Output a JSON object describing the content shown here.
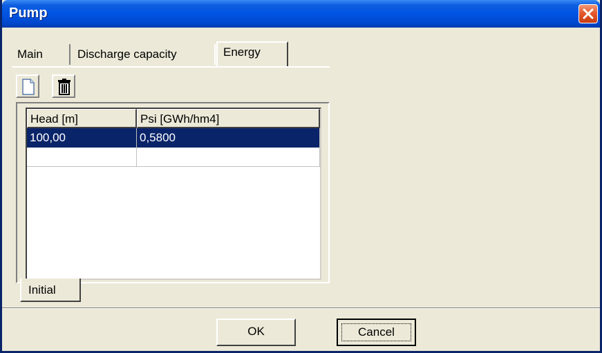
{
  "window": {
    "title": "Pump"
  },
  "tabs": [
    {
      "label": "Main"
    },
    {
      "label": "Discharge capacity"
    },
    {
      "label": "Energy"
    }
  ],
  "active_tab": "Energy",
  "toolbar": {
    "new_icon": "new-document-icon",
    "delete_icon": "trash-icon"
  },
  "grid": {
    "columns": [
      "Head [m]",
      "Psi [GWh/hm4]"
    ],
    "rows": [
      [
        "100,00",
        "0,5800"
      ],
      [
        "",
        ""
      ]
    ],
    "selected_row": 0
  },
  "bottom_tab": {
    "label": "Initial"
  },
  "buttons": {
    "ok": "OK",
    "cancel": "Cancel"
  },
  "colors": {
    "titlebar": "#0054e3",
    "selection": "#0a246a",
    "close": "#e35a2e",
    "face": "#ece9d8"
  }
}
